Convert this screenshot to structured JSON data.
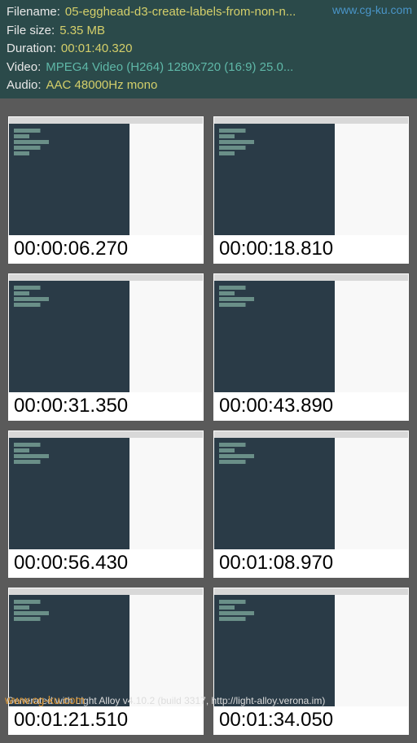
{
  "header": {
    "filename_label": "Filename:",
    "filename_value": "05-egghead-d3-create-labels-from-non-n...",
    "filesize_label": "File size:",
    "filesize_value": "5.35 MB",
    "duration_label": "Duration:",
    "duration_value": "00:01:40.320",
    "video_label": "Video:",
    "video_value": "MPEG4 Video (H264) 1280x720 (16:9) 25.0...",
    "audio_label": "Audio:",
    "audio_value": "AAC 48000Hz mono"
  },
  "watermark_top": "www.cg-ku.com",
  "watermark_bottom": "www.cg-ku.com",
  "thumbnails": [
    {
      "timestamp": "00:00:06.270"
    },
    {
      "timestamp": "00:00:18.810"
    },
    {
      "timestamp": "00:00:31.350"
    },
    {
      "timestamp": "00:00:43.890"
    },
    {
      "timestamp": "00:00:56.430"
    },
    {
      "timestamp": "00:01:08.970"
    },
    {
      "timestamp": "00:01:21.510"
    },
    {
      "timestamp": "00:01:34.050"
    }
  ],
  "footer": "Generated with Light Alloy v4.10.2 (build 3317, http://light-alloy.verona.im)"
}
